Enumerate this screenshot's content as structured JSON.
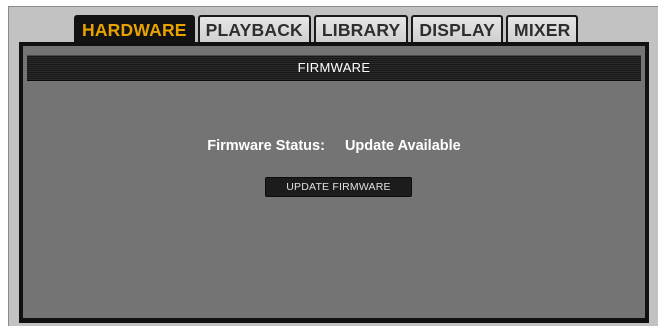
{
  "tabs": [
    {
      "label": "HARDWARE",
      "active": true
    },
    {
      "label": "PLAYBACK",
      "active": false
    },
    {
      "label": "LIBRARY",
      "active": false
    },
    {
      "label": "DISPLAY",
      "active": false
    },
    {
      "label": "MIXER",
      "active": false
    }
  ],
  "panel": {
    "title": "FIRMWARE",
    "status_label": "Firmware Status:",
    "status_value": "Update Available",
    "update_button_label": "UPDATE FIRMWARE"
  },
  "colors": {
    "active_tab_text": "#e8a300",
    "active_tab_bg": "#121212",
    "panel_bg": "#747474",
    "frame_bg": "#c2c2c2"
  }
}
